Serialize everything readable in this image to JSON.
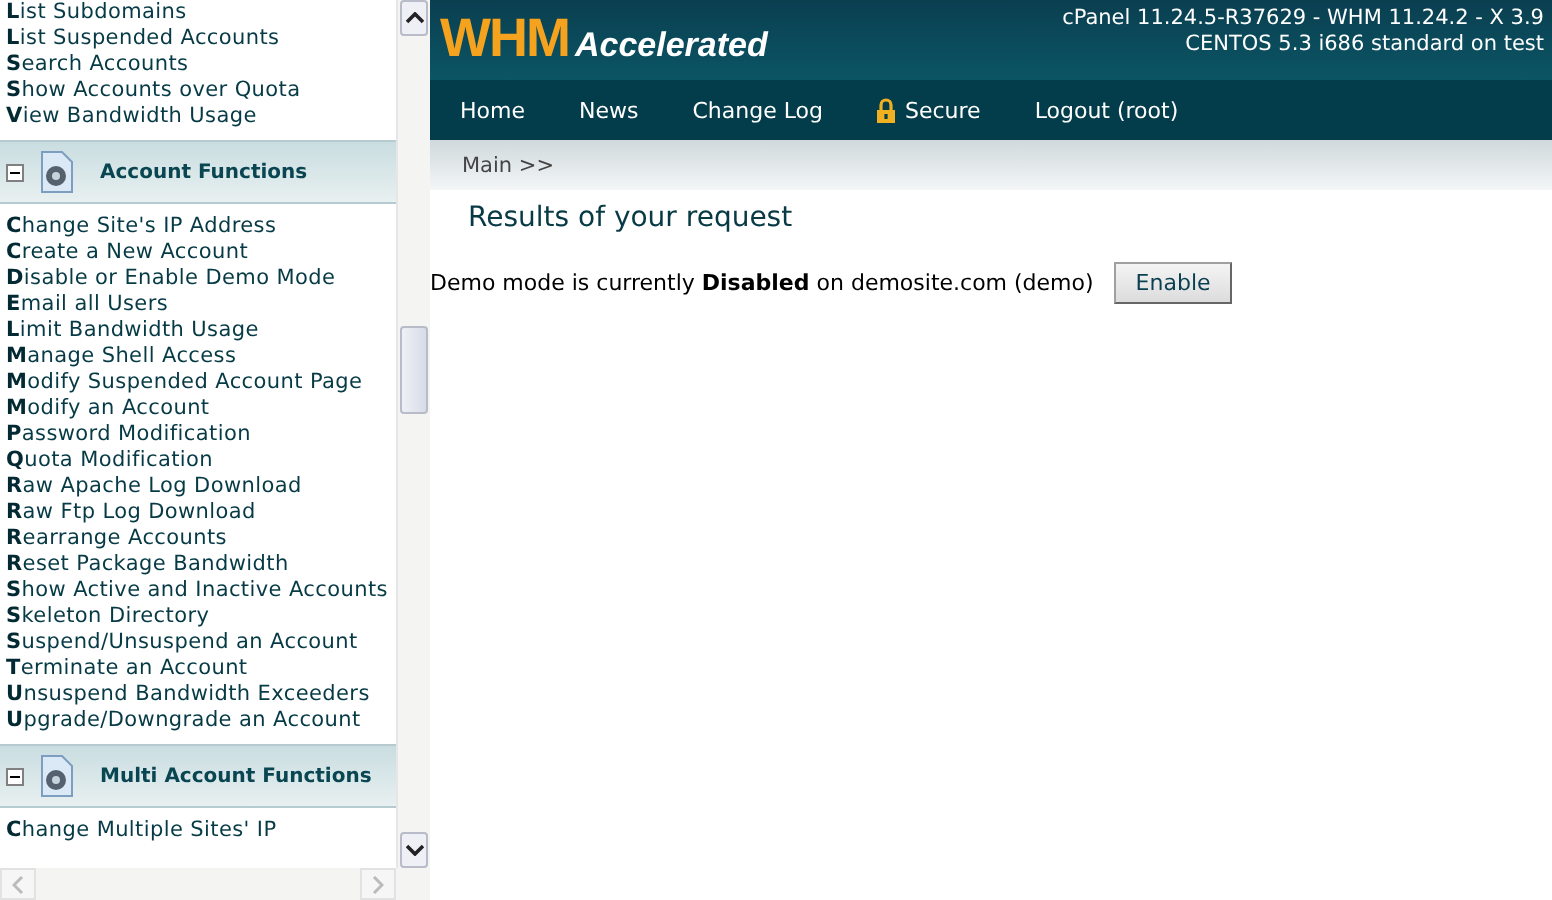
{
  "sidebar": {
    "entries": [
      {
        "kind": "link",
        "label": "**L**ist Subdomains"
      },
      {
        "kind": "link",
        "label": "**L**ist Suspended Accounts"
      },
      {
        "kind": "link",
        "label": "**S**earch Accounts"
      },
      {
        "kind": "link",
        "label": "**S**how Accounts over Quota"
      },
      {
        "kind": "link",
        "label": "**V**iew Bandwidth Usage"
      },
      {
        "kind": "section",
        "label": "Account Functions",
        "expanded": true
      },
      {
        "kind": "link",
        "label": "**C**hange Site's IP Address"
      },
      {
        "kind": "link",
        "label": "**C**reate a New Account"
      },
      {
        "kind": "link",
        "label": "**D**isable or Enable Demo Mode"
      },
      {
        "kind": "link",
        "label": "**E**mail all Users"
      },
      {
        "kind": "link",
        "label": "**L**imit Bandwidth Usage"
      },
      {
        "kind": "link",
        "label": "**M**anage Shell Access"
      },
      {
        "kind": "link",
        "label": "**M**odify Suspended Account Page"
      },
      {
        "kind": "link",
        "label": "**M**odify an Account"
      },
      {
        "kind": "link",
        "label": "**P**assword Modification"
      },
      {
        "kind": "link",
        "label": "**Q**uota Modification"
      },
      {
        "kind": "link",
        "label": "**R**aw Apache Log Download"
      },
      {
        "kind": "link",
        "label": "**R**aw Ftp Log Download"
      },
      {
        "kind": "link",
        "label": "**R**earrange Accounts"
      },
      {
        "kind": "link",
        "label": "**R**eset Package Bandwidth"
      },
      {
        "kind": "link",
        "label": "**S**how Active and Inactive Accounts"
      },
      {
        "kind": "link",
        "label": "**S**keleton Directory"
      },
      {
        "kind": "link",
        "label": "**S**uspend/Unsuspend an Account"
      },
      {
        "kind": "link",
        "label": "**T**erminate an Account"
      },
      {
        "kind": "link",
        "label": "**U**nsuspend Bandwidth Exceeders"
      },
      {
        "kind": "link",
        "label": "**U**pgrade/Downgrade an Account"
      },
      {
        "kind": "section",
        "label": "Multi Account Functions",
        "expanded": true
      },
      {
        "kind": "link",
        "label": "**C**hange Multiple Sites' IP"
      }
    ]
  },
  "header": {
    "logo_main": "WHM",
    "logo_sub": "Accelerated",
    "version_lines": [
      "cPanel 11.24.5-R37629 - WHM 11.24.2 - X 3.9",
      "CENTOS 5.3 i686 standard on test"
    ]
  },
  "nav": [
    {
      "label": "Home",
      "kind": "plain"
    },
    {
      "label": "News",
      "kind": "plain"
    },
    {
      "label": "Change Log",
      "kind": "plain"
    },
    {
      "label": "Secure",
      "kind": "locked"
    },
    {
      "label": "Logout (root)",
      "kind": "plain"
    }
  ],
  "breadcrumb": "Main >>",
  "heading": "Results of your request",
  "message": "Demo mode is currently **Disabled** on demosite.com (demo)",
  "action_button": "Enable"
}
